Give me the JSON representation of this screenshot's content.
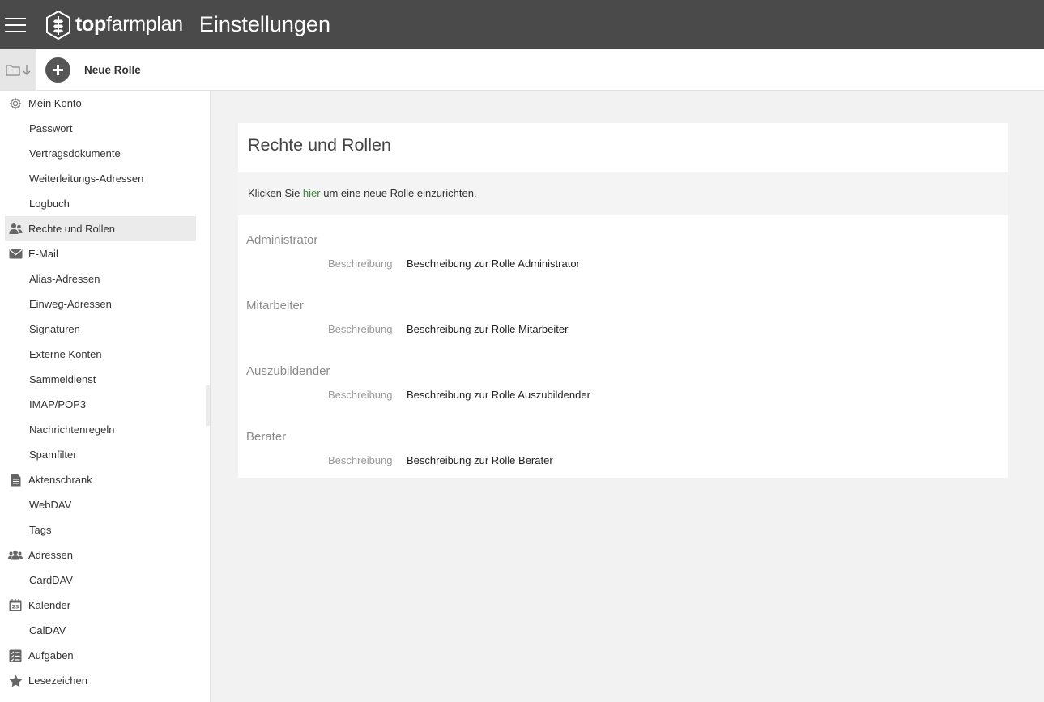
{
  "header": {
    "logo_bold": "top",
    "logo_regular": "farmplan",
    "title": "Einstellungen"
  },
  "toolbar": {
    "new_role_label": "Neue Rolle"
  },
  "sidebar": {
    "items": [
      {
        "label": "Mein Konto",
        "icon": "gear-icon"
      },
      {
        "label": "Passwort"
      },
      {
        "label": "Vertragsdokumente"
      },
      {
        "label": "Weiterleitungs-Adressen"
      },
      {
        "label": "Logbuch"
      },
      {
        "label": "Rechte und Rollen",
        "icon": "users-icon"
      },
      {
        "label": "E-Mail",
        "icon": "envelope-icon"
      },
      {
        "label": "Alias-Adressen"
      },
      {
        "label": "Einweg-Adressen"
      },
      {
        "label": "Signaturen"
      },
      {
        "label": "Externe Konten"
      },
      {
        "label": "Sammeldienst"
      },
      {
        "label": "IMAP/POP3"
      },
      {
        "label": "Nachrichtenregeln"
      },
      {
        "label": "Spamfilter"
      },
      {
        "label": "Aktenschrank",
        "icon": "document-icon"
      },
      {
        "label": "WebDAV"
      },
      {
        "label": "Tags"
      },
      {
        "label": "Adressen",
        "icon": "contacts-icon"
      },
      {
        "label": "CardDAV"
      },
      {
        "label": "Kalender",
        "icon": "calendar-icon",
        "icon_text": "23"
      },
      {
        "label": "CalDAV"
      },
      {
        "label": "Aufgaben",
        "icon": "tasks-icon"
      },
      {
        "label": "Lesezeichen",
        "icon": "star-icon"
      }
    ],
    "active": "Rechte und Rollen"
  },
  "main": {
    "title": "Rechte und Rollen",
    "info_prefix": "Klicken Sie ",
    "info_link": "hier",
    "info_suffix": " um eine neue Rolle einzurichten.",
    "roles": [
      {
        "name": "Administrator",
        "desc_label": "Beschreibung",
        "desc": "Beschreibung zur Rolle Administrator"
      },
      {
        "name": "Mitarbeiter",
        "desc_label": "Beschreibung",
        "desc": "Beschreibung zur Rolle Mitarbeiter"
      },
      {
        "name": "Auszubildender",
        "desc_label": "Beschreibung",
        "desc": "Beschreibung zur Rolle Auszubildender"
      },
      {
        "name": "Berater",
        "desc_label": "Beschreibung",
        "desc": "Beschreibung zur Rolle Berater"
      }
    ]
  },
  "colors": {
    "header_bg": "#4a4a4a",
    "link": "#3a8a3a",
    "active_item_bg": "#ebebeb"
  }
}
